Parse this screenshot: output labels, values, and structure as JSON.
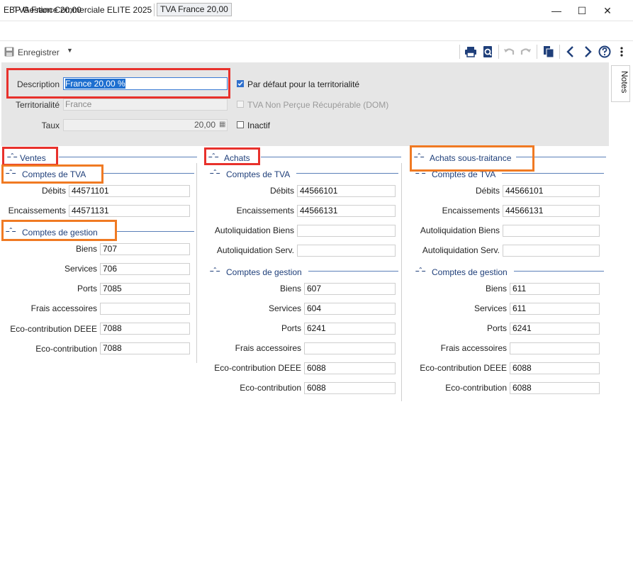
{
  "window": {
    "title": "TVA France 20,00"
  },
  "breadcrumb": {
    "app": "EBP Gestion Commerciale ELITE 2025",
    "doc": "TVA France 20,00"
  },
  "toolbar": {
    "save_label": "Enregistrer"
  },
  "notes_tab": "Notes",
  "header": {
    "description_label": "Description",
    "description_value": "France 20,00 %",
    "territorialite_label": "Territorialité",
    "territorialite_value": "France",
    "taux_label": "Taux",
    "taux_value": "20,00",
    "default_label": "Par défaut pour la territorialité",
    "default_checked": true,
    "dom_label": "TVA Non Perçue Récupérable (DOM)",
    "dom_checked": false,
    "inactif_label": "Inactif",
    "inactif_checked": false
  },
  "ventes": {
    "title": "Ventes",
    "tva_title": "Comptes de TVA",
    "debits_label": "Débits",
    "debits": "44571101",
    "encaissements_label": "Encaissements",
    "encaissements": "44571131",
    "gestion_title": "Comptes de gestion",
    "biens_label": "Biens",
    "biens": "707",
    "services_label": "Services",
    "services": "706",
    "ports_label": "Ports",
    "ports": "7085",
    "frais_label": "Frais accessoires",
    "frais": "",
    "deee_label": "Eco-contribution DEEE",
    "deee": "7088",
    "eco_label": "Eco-contribution",
    "eco": "7088"
  },
  "achats": {
    "title": "Achats",
    "tva_title": "Comptes de TVA",
    "debits_label": "Débits",
    "debits": "44566101",
    "encaissements_label": "Encaissements",
    "encaissements": "44566131",
    "autobiens_label": "Autoliquidation Biens",
    "autobiens": "",
    "autoserv_label": "Autoliquidation Serv.",
    "autoserv": "",
    "gestion_title": "Comptes de gestion",
    "biens_label": "Biens",
    "biens": "607",
    "services_label": "Services",
    "services": "604",
    "ports_label": "Ports",
    "ports": "6241",
    "frais_label": "Frais accessoires",
    "frais": "",
    "deee_label": "Eco-contribution DEEE",
    "deee": "6088",
    "eco_label": "Eco-contribution",
    "eco": "6088"
  },
  "soustraitance": {
    "title": "Achats sous-traitance",
    "tva_title": "Comptes de TVA",
    "debits_label": "Débits",
    "debits": "44566101",
    "encaissements_label": "Encaissements",
    "encaissements": "44566131",
    "autobiens_label": "Autoliquidation Biens",
    "autobiens": "",
    "autoserv_label": "Autoliquidation Serv.",
    "autoserv": "",
    "gestion_title": "Comptes de gestion",
    "biens_label": "Biens",
    "biens": "611",
    "services_label": "Services",
    "services": "611",
    "ports_label": "Ports",
    "ports": "6241",
    "frais_label": "Frais accessoires",
    "frais": "",
    "deee_label": "Eco-contribution DEEE",
    "deee": "6088",
    "eco_label": "Eco-contribution",
    "eco": "6088"
  },
  "colors": {
    "accent": "#1f3f7a",
    "highlight_red": "#e8312c",
    "highlight_orange": "#f07a23",
    "header_bg": "#e6e6e6"
  }
}
